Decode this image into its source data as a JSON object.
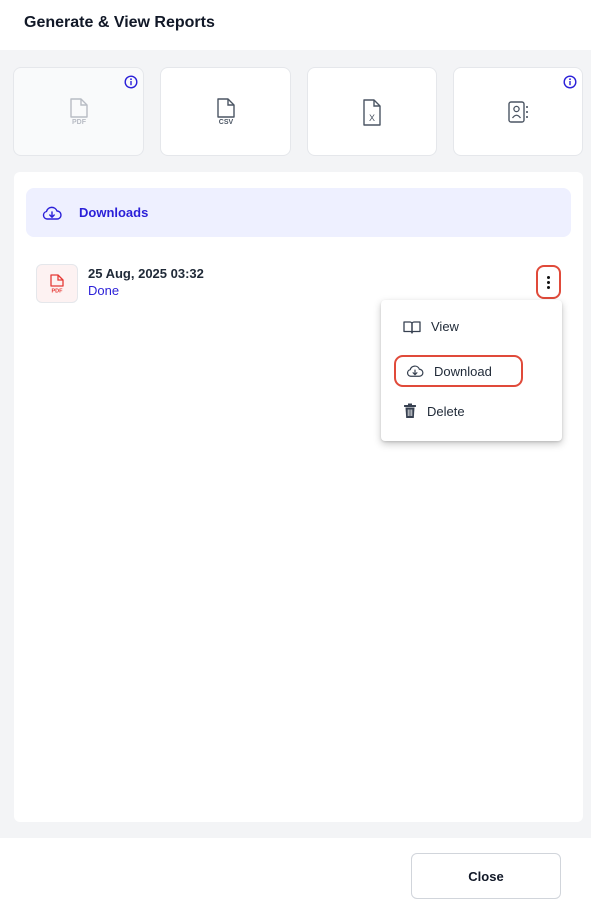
{
  "header": {
    "title": "Generate & View Reports"
  },
  "report_types": [
    {
      "icon": "pdf-file-icon",
      "text": "PDF",
      "has_info": true,
      "state": "disabled"
    },
    {
      "icon": "csv-file-icon",
      "text": "CSV",
      "has_info": false,
      "state": "enabled"
    },
    {
      "icon": "excel-file-icon",
      "text": "X",
      "has_info": false,
      "state": "enabled"
    },
    {
      "icon": "contact-file-icon",
      "has_info": true,
      "state": "enabled"
    }
  ],
  "downloads": {
    "label": "Downloads",
    "items": [
      {
        "date": "25 Aug, 2025 03:32",
        "status": "Done",
        "file_type": "PDF"
      }
    ]
  },
  "context_menu": {
    "items": [
      {
        "label": "View",
        "icon": "book-open-icon"
      },
      {
        "label": "Download",
        "icon": "cloud-download-icon",
        "highlighted": true
      },
      {
        "label": "Delete",
        "icon": "trash-icon"
      }
    ]
  },
  "footer": {
    "close_label": "Close"
  },
  "colors": {
    "accent": "#2a1fd8",
    "highlight_outline": "#e04a3a",
    "downloads_bg": "#eef0ff",
    "pdf_red": "#e53935"
  }
}
